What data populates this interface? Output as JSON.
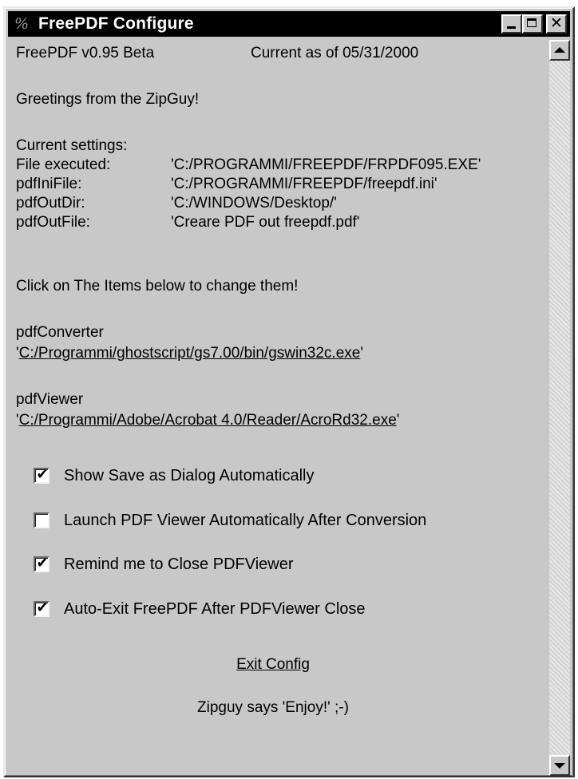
{
  "window": {
    "title": "FreePDF Configure",
    "icon": "freepdf-app-icon"
  },
  "header": {
    "version": "FreePDF v0.95 Beta",
    "current_as_of": "Current as of 05/31/2000"
  },
  "greeting": "Greetings from the ZipGuy!",
  "settings": {
    "heading": "Current settings:",
    "rows": [
      {
        "label": "File executed:",
        "value": "'C:/PROGRAMMI/FREEPDF/FRPDF095.EXE'"
      },
      {
        "label": "pdfIniFile:",
        "value": "'C:/PROGRAMMI/FREEPDF/freepdf.ini'"
      },
      {
        "label": "pdfOutDir:",
        "value": "'C:/WINDOWS/Desktop/'"
      },
      {
        "label": "pdfOutFile:",
        "value": "'Creare PDF out freepdf.pdf'"
      }
    ]
  },
  "instructions": "Click on The Items below to change them!",
  "converter": {
    "label": "pdfConverter",
    "quote_open": "'",
    "path": "C:/Programmi/ghostscript/gs7.00/bin/gswin32c.exe",
    "quote_close": "'"
  },
  "viewer": {
    "label": "pdfViewer",
    "quote_open": "'",
    "path": "C:/Programmi/Adobe/Acrobat 4.0/Reader/AcroRd32.exe",
    "quote_close": "'"
  },
  "options": [
    {
      "label": "Show Save as Dialog Automatically",
      "checked": true
    },
    {
      "label": "Launch PDF Viewer Automatically After Conversion",
      "checked": false
    },
    {
      "label": "Remind me to Close PDFViewer",
      "checked": true
    },
    {
      "label": "Auto-Exit FreePDF After PDFViewer Close",
      "checked": true
    }
  ],
  "check_glyph": "✔",
  "exit_link": "Exit Config",
  "footer": "Zipguy says 'Enjoy!' ;-)",
  "colors": {
    "titlebar": "#000000",
    "window_bg": "#c8c8c8",
    "text": "#000000"
  }
}
